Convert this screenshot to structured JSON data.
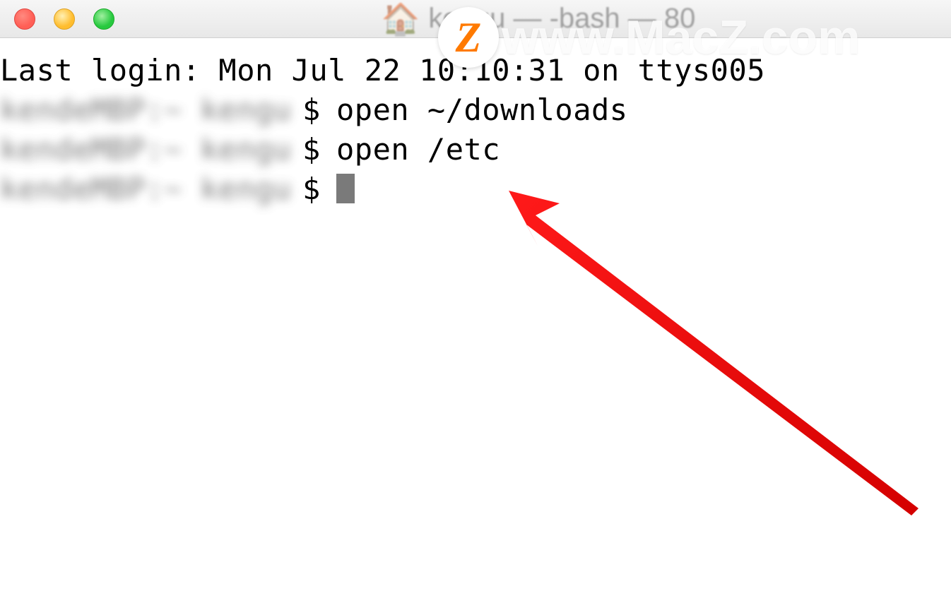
{
  "titlebar": {
    "title_blurred": "kengu — -bash — 80",
    "home_icon": "🏠"
  },
  "watermark": {
    "badge_letter": "Z",
    "text": "www.MacZ.com"
  },
  "terminal": {
    "last_login": "Last login: Mon Jul 22 10:10:31 on ttys005",
    "blurred_host": "kendeMBP:~ kengu",
    "prompt_symbol": "$",
    "lines": [
      {
        "command": "open ~/downloads"
      },
      {
        "command": "open /etc"
      },
      {
        "command": ""
      }
    ]
  }
}
